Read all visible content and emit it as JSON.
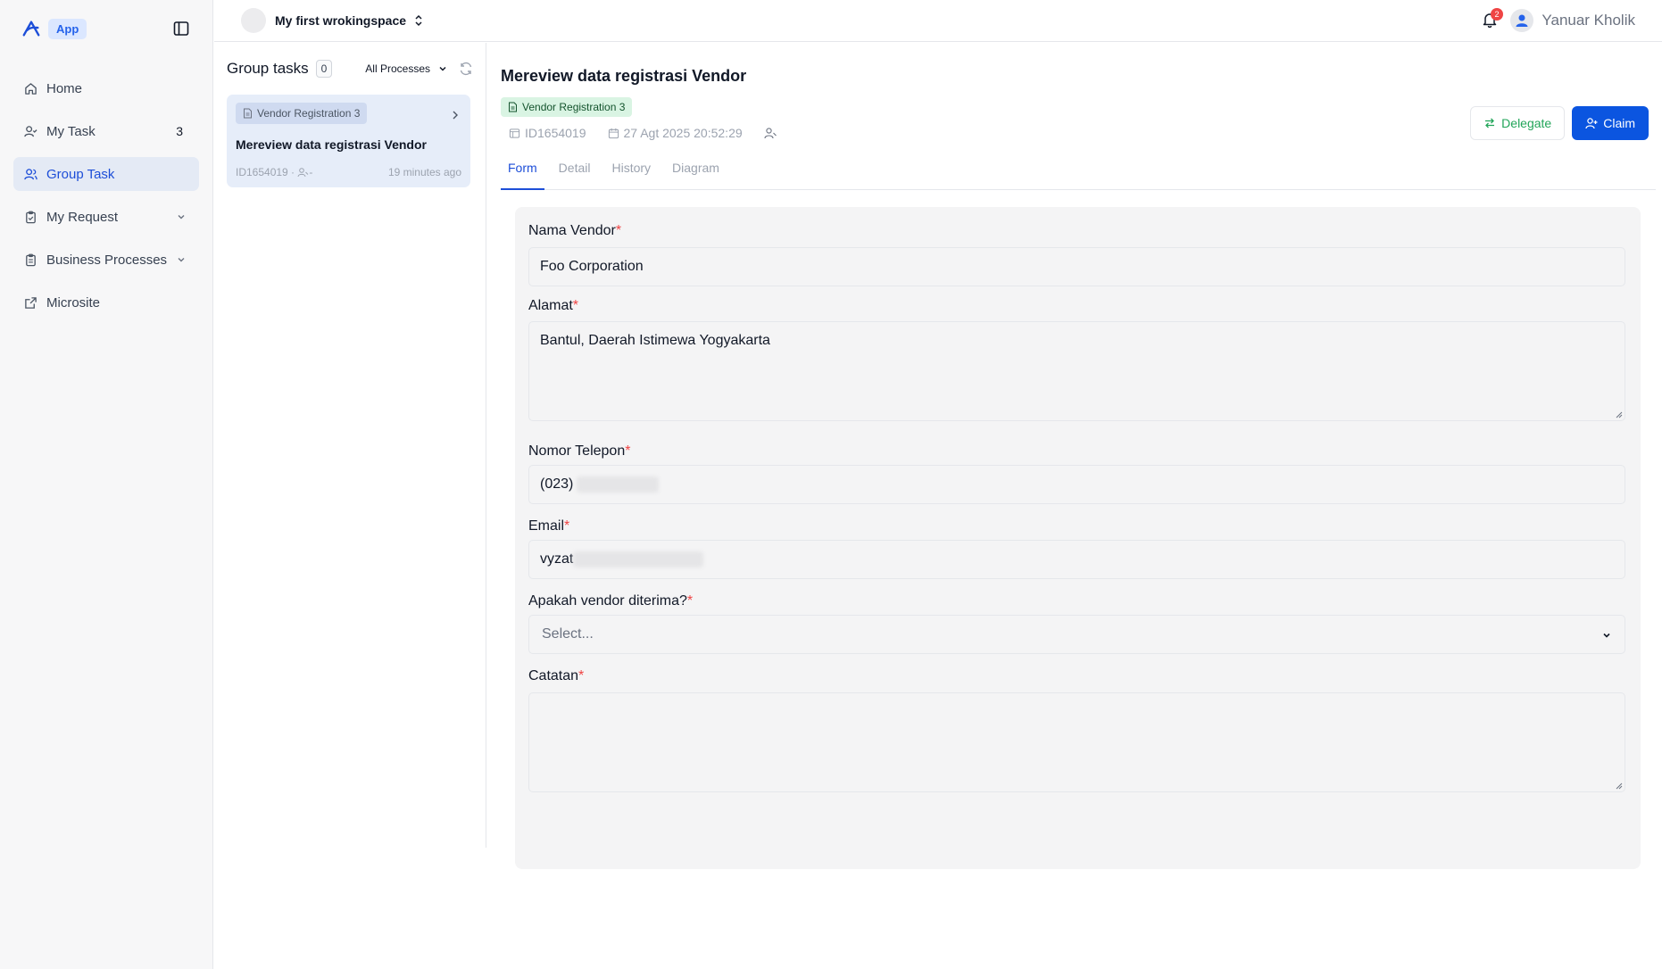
{
  "app": {
    "badge": "App"
  },
  "sidebar": {
    "items": [
      {
        "label": "Home",
        "icon": "home-icon"
      },
      {
        "label": "My Task",
        "icon": "user-check-icon",
        "count": "3"
      },
      {
        "label": "Group Task",
        "icon": "users-icon",
        "active": true
      },
      {
        "label": "My Request",
        "icon": "clipboard-icon"
      },
      {
        "label": "Business Processes",
        "icon": "clipboard-list-icon"
      },
      {
        "label": "Microsite",
        "icon": "external-link-icon"
      }
    ]
  },
  "topbar": {
    "workspace": "My first wrokingspace",
    "notification_count": "2",
    "user_name": "Yanuar Kholik"
  },
  "group_panel": {
    "title": "Group tasks",
    "count": "0",
    "filter": "All Processes",
    "task": {
      "tag": "Vendor Registration 3",
      "title": "Mereview data registrasi Vendor",
      "id": "ID1654019",
      "assignee": "-",
      "ago": "19 minutes ago"
    }
  },
  "main": {
    "title": "Mereview data registrasi Vendor",
    "tag": "Vendor Registration 3",
    "id": "ID1654019",
    "date": "27 Agt 2025 20:52:29",
    "delegate_label": "Delegate",
    "claim_label": "Claim",
    "tabs": [
      "Form",
      "Detail",
      "History",
      "Diagram"
    ]
  },
  "form": {
    "nama_vendor": {
      "label": "Nama Vendor",
      "value": "Foo Corporation"
    },
    "alamat": {
      "label": "Alamat",
      "value": "Bantul, Daerah Istimewa Yogyakarta"
    },
    "telepon": {
      "label": "Nomor Telepon",
      "value": "(023)"
    },
    "email": {
      "label": "Email",
      "value": "vyzat"
    },
    "diterima": {
      "label": "Apakah vendor diterima?",
      "placeholder": "Select..."
    },
    "catatan": {
      "label": "Catatan",
      "value": ""
    },
    "required_mark": "*"
  },
  "colors": {
    "accent": "#0b55e0",
    "active_nav_bg": "#e4eaf5",
    "delegate_text": "#22a559",
    "required": "#ef4444"
  }
}
